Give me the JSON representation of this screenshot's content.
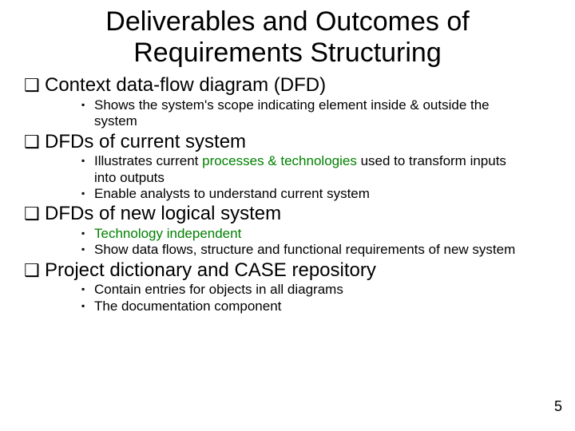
{
  "slide": {
    "title_line1": "Deliverables and Outcomes of",
    "title_line2": "Requirements Structuring",
    "page_number": "5",
    "b1": {
      "label": "Context data-flow diagram (DFD)",
      "s1": "Shows the system's scope indicating element inside & outside the system"
    },
    "b2": {
      "label": "DFDs of current system",
      "s1_pre": "Illustrates current ",
      "s1_green": "processes & technologies",
      "s1_post": " used to transform inputs into outputs",
      "s2": "Enable analysts to understand current system"
    },
    "b3": {
      "label": "DFDs of new logical system",
      "s1": "Technology independent",
      "s2": "Show data flows, structure and functional requirements of new system"
    },
    "b4": {
      "label": "Project dictionary and CASE repository",
      "s1": "Contain entries for objects in all diagrams",
      "s2": "The documentation component"
    }
  }
}
